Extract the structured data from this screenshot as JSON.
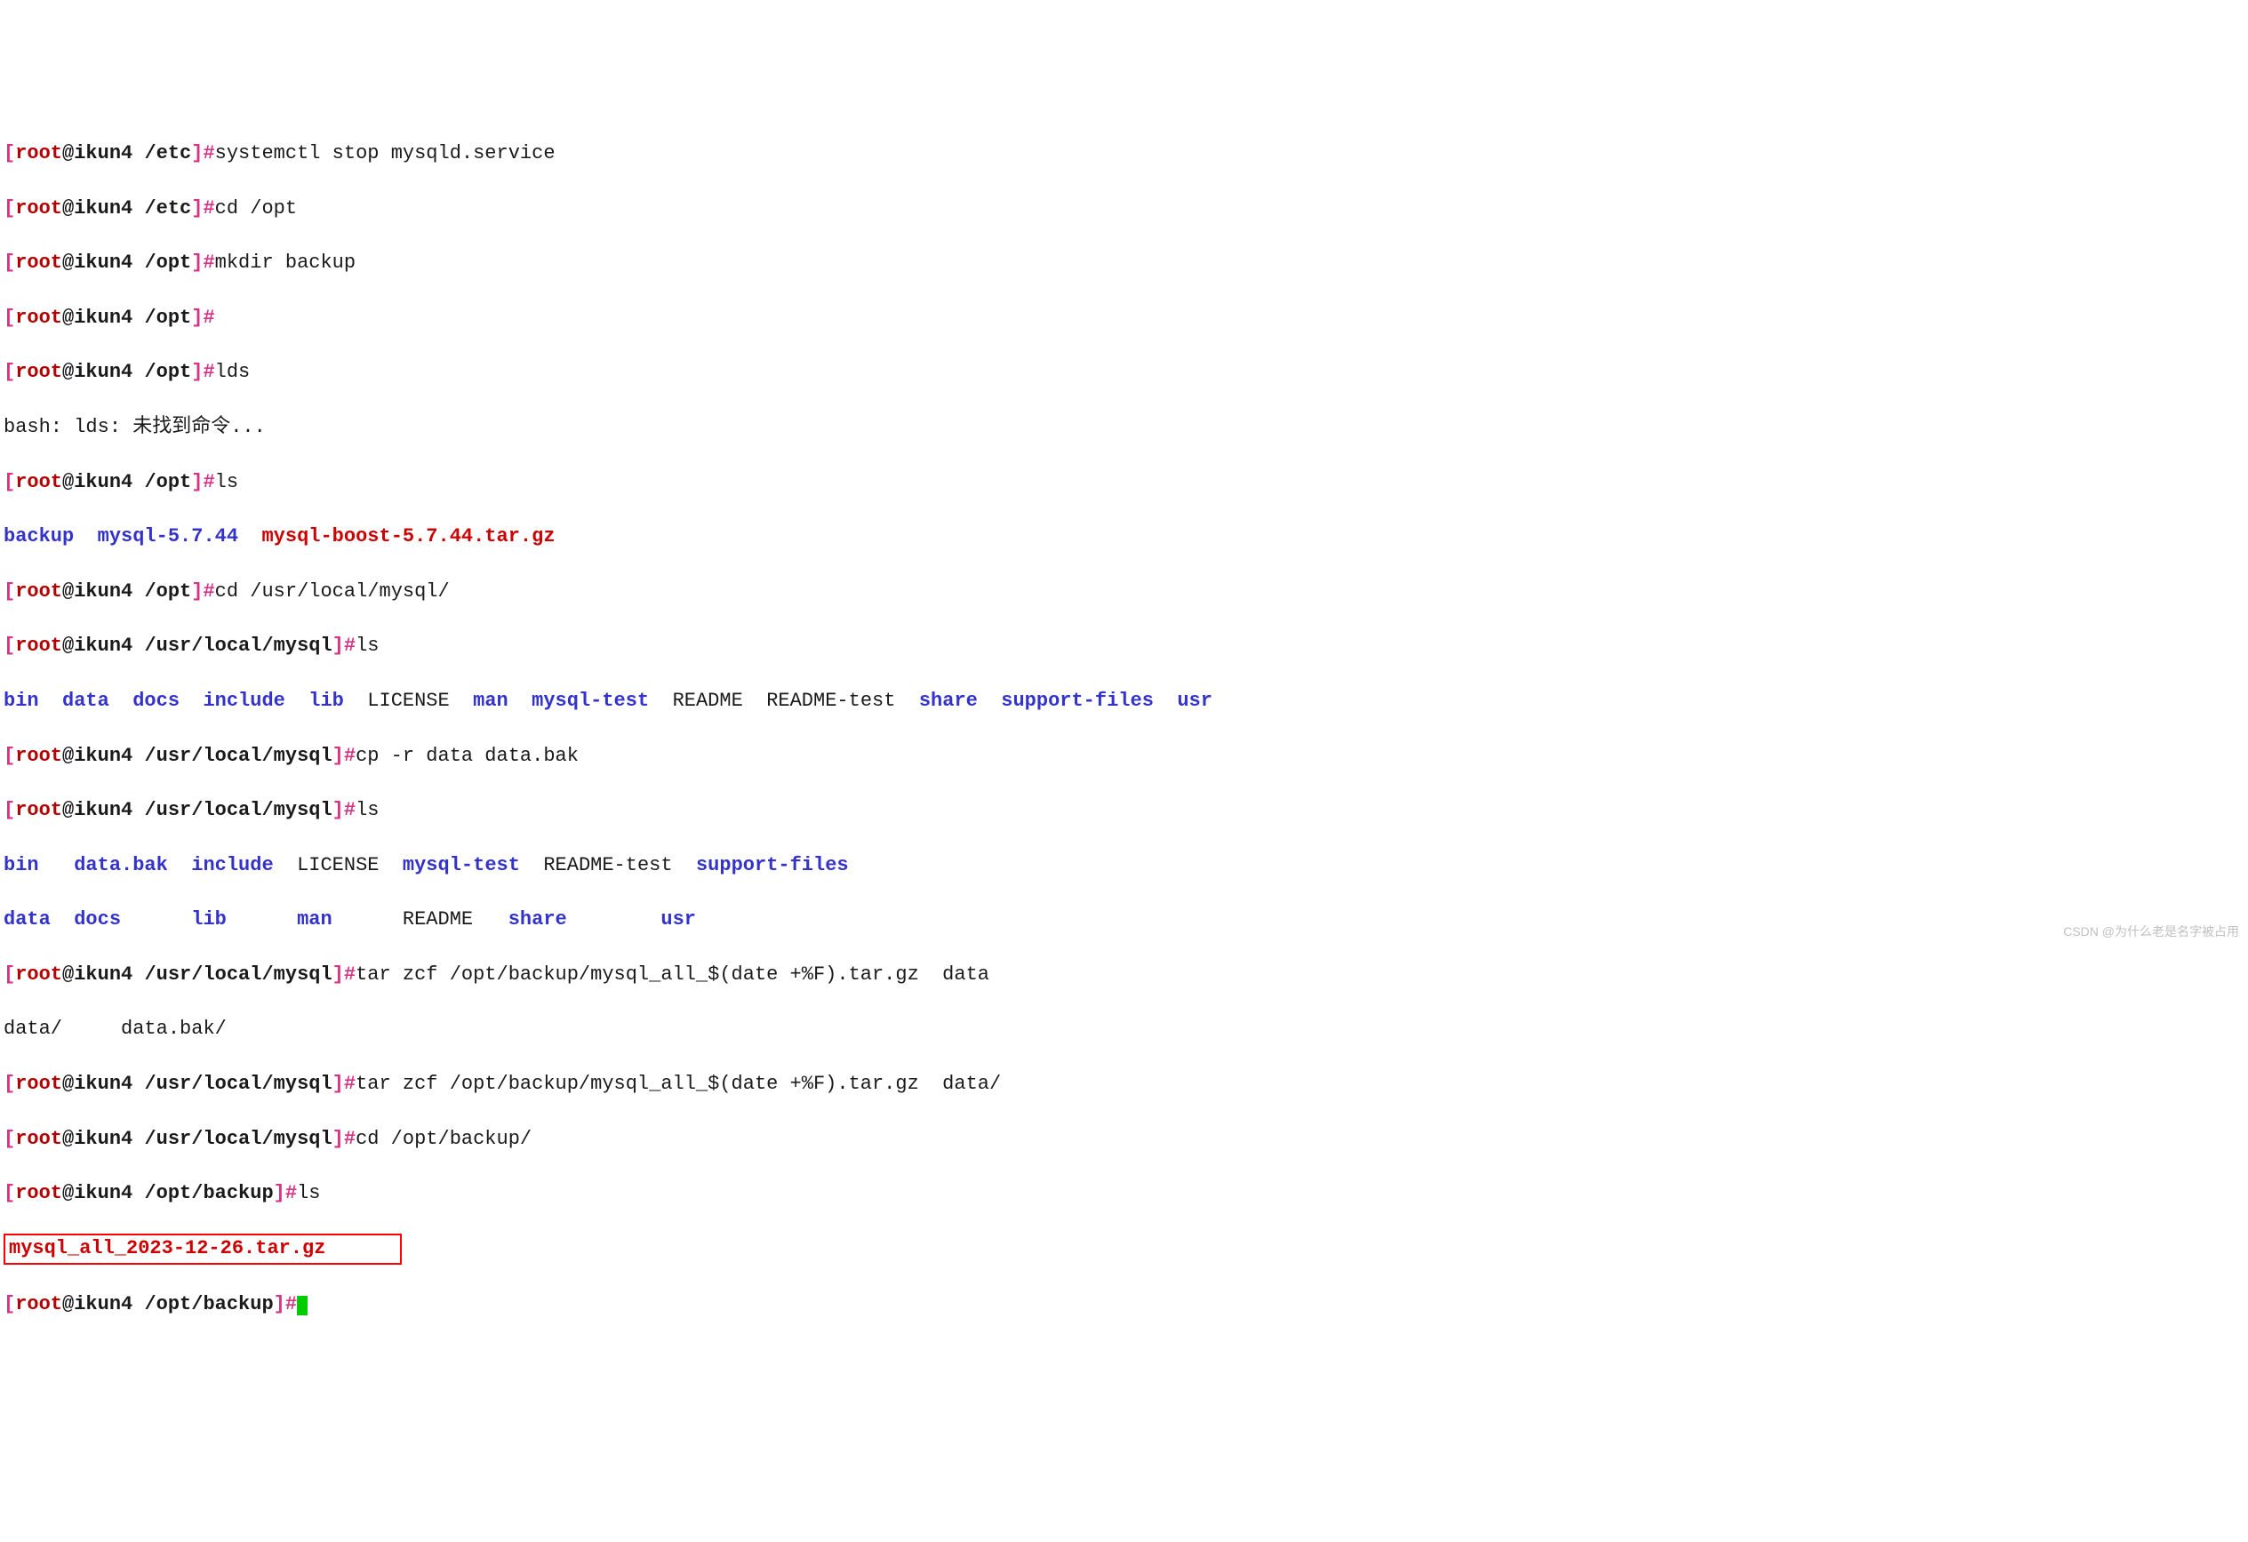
{
  "prompts": {
    "etc": {
      "open": "[",
      "user": "root",
      "at": "@",
      "host": "ikun4 ",
      "path": "/etc",
      "close": "]",
      "hash": "#"
    },
    "opt": {
      "open": "[",
      "user": "root",
      "at": "@",
      "host": "ikun4 ",
      "path": "/opt",
      "close": "]",
      "hash": "#"
    },
    "mysql": {
      "open": "[",
      "user": "root",
      "at": "@",
      "host": "ikun4 ",
      "path": "/usr/local/mysql",
      "close": "]",
      "hash": "#"
    },
    "backup": {
      "open": "[",
      "user": "root",
      "at": "@",
      "host": "ikun4 ",
      "path": "/opt/backup",
      "close": "]",
      "hash": "#"
    }
  },
  "cmds": {
    "c1": "systemctl stop mysqld.service",
    "c2": "cd /opt",
    "c3": "mkdir backup",
    "c4": "",
    "c5": "lds",
    "c6": "ls",
    "c7": "cd /usr/local/mysql/",
    "c8": "ls",
    "c9": "cp -r data data.bak",
    "c10": "ls",
    "c11": "tar zcf /opt/backup/mysql_all_$(date +%F).tar.gz  data",
    "c12": "tar zcf /opt/backup/mysql_all_$(date +%F).tar.gz  data/",
    "c13": "cd /opt/backup/",
    "c14": "ls"
  },
  "out": {
    "lds_err": "bash: lds: 未找到命令...",
    "ls1_a": "backup",
    "ls1_b": "mysql-5.7.44",
    "ls1_c": "mysql-boost-5.7.44.tar.gz",
    "ls2_a": "bin",
    "ls2_b": "data",
    "ls2_c": "docs",
    "ls2_d": "include",
    "ls2_e": "lib",
    "ls2_f": "LICENSE",
    "ls2_g": "man",
    "ls2_h": "mysql-test",
    "ls2_i": "README",
    "ls2_j": "README-test",
    "ls2_k": "share",
    "ls2_l": "support-files",
    "ls2_m": "usr",
    "ls3_r1a": "bin",
    "ls3_r1b": "data.bak",
    "ls3_r1c": "include",
    "ls3_r1d": "LICENSE",
    "ls3_r1e": "mysql-test",
    "ls3_r1f": "README-test",
    "ls3_r1g": "support-files",
    "ls3_r2a": "data",
    "ls3_r2b": "docs",
    "ls3_r2c": "lib",
    "ls3_r2d": "man",
    "ls3_r2e": "README",
    "ls3_r2f": "share",
    "ls3_r2g": "usr",
    "tab_a": "data/",
    "tab_b": "data.bak/",
    "result": "mysql_all_2023-12-26.tar.gz"
  },
  "watermark": "CSDN @为什么老是名字被占用"
}
